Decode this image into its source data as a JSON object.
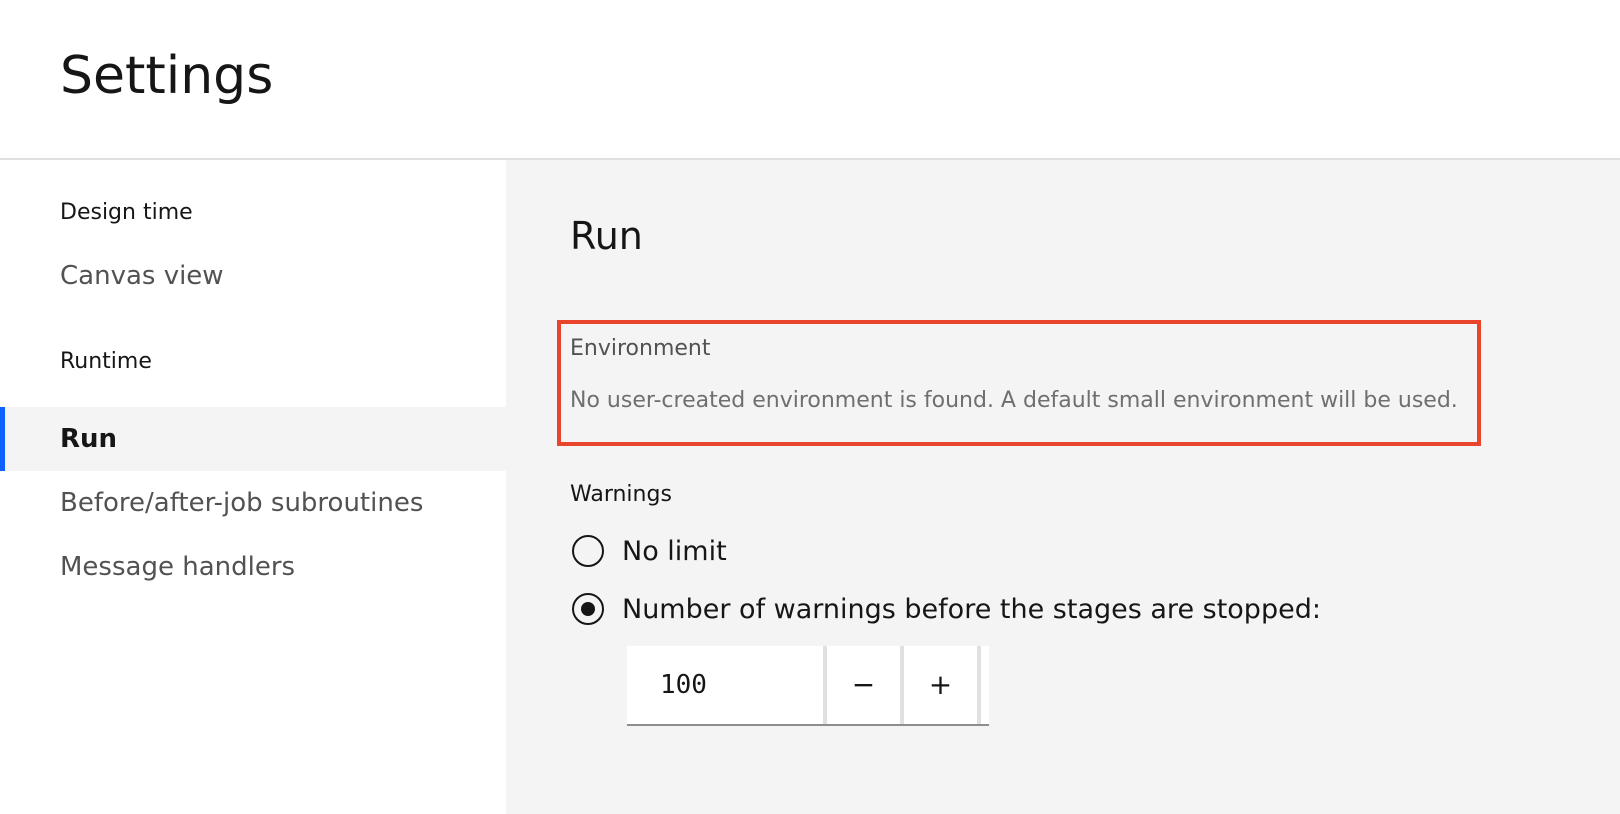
{
  "header": {
    "title": "Settings"
  },
  "sidebar": {
    "sections": [
      {
        "heading": "Design time",
        "items": [
          {
            "label": "Canvas view",
            "active": false
          }
        ]
      },
      {
        "heading": "Runtime",
        "items": [
          {
            "label": "Run",
            "active": true
          },
          {
            "label": "Before/after-job subroutines",
            "active": false
          },
          {
            "label": "Message handlers",
            "active": false
          }
        ]
      }
    ]
  },
  "main": {
    "title": "Run",
    "environment": {
      "label": "Environment",
      "message": "No user-created environment is found. A default small environment will be used."
    },
    "warnings": {
      "label": "Warnings",
      "options": [
        {
          "label": "No limit",
          "selected": false
        },
        {
          "label": "Number of warnings before the stages are stopped:",
          "selected": true
        }
      ],
      "stepper": {
        "value": "100",
        "decrement_label": "−",
        "increment_label": "+"
      }
    }
  },
  "colors": {
    "accent": "#0f62fe",
    "highlight_border": "#e8452c",
    "panel_background": "#f4f4f4"
  }
}
